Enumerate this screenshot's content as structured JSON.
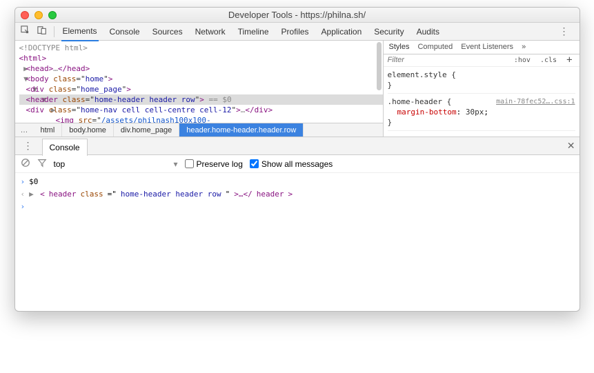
{
  "window": {
    "title": "Developer Tools - https://philna.sh/"
  },
  "tabs": [
    "Elements",
    "Console",
    "Sources",
    "Network",
    "Timeline",
    "Profiles",
    "Application",
    "Security",
    "Audits"
  ],
  "active_tab": 0,
  "dom": {
    "doctype": "<!DOCTYPE html>",
    "html_open": "html",
    "head": "head",
    "body_tag": "body",
    "body_class": "home",
    "div1": "div",
    "div1_class": "home_page",
    "header_tag": "header",
    "header_class": "home-header header row",
    "eq0": " == $0",
    "div2": "div",
    "div2_class": "home-nav cell cell-centre cell-12",
    "ellipsis": "…",
    "closediv": "/div",
    "img": "img",
    "img_src": "/assets/philnash100x100-"
  },
  "breadcrumbs": [
    "html",
    "body.home",
    "div.home_page",
    "header.home-header.header.row"
  ],
  "styles": {
    "tabs": [
      "Styles",
      "Computed",
      "Event Listeners"
    ],
    "filter_placeholder": "Filter",
    "hov": ":hov",
    "cls": ".cls",
    "rule1_sel": "element.style {",
    "rule1_close": "}",
    "rule2_sel": ".home-header {",
    "rule2_src": "main-78fec52….css:1",
    "rule2_prop": "margin-bottom",
    "rule2_val": "30px",
    "rule2_close": "}"
  },
  "drawer": {
    "tab": "Console",
    "context": "top",
    "preserve": "Preserve log",
    "showall": "Show all messages",
    "line1": "$0",
    "line2_pre": "<",
    "line2_tag": "header",
    "line2_attr": "class",
    "line2_val": "home-header header row",
    "line2_mid": ">…</",
    "line2_end": ">"
  }
}
